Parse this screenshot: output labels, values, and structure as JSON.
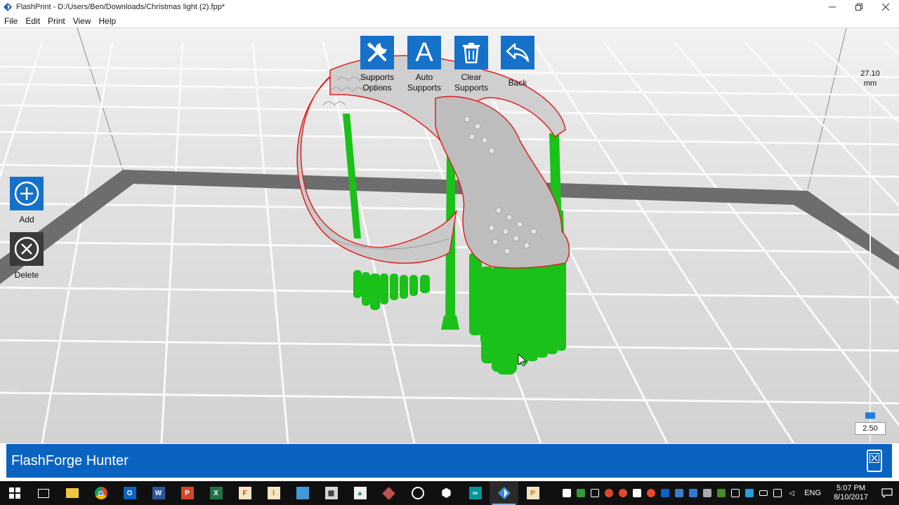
{
  "window": {
    "title": "FlashPrint - D:/Users/Ben/Downloads/Christmas light (2).fpp*",
    "app_icon": "flashprint-logo-icon"
  },
  "menu": {
    "items": [
      "File",
      "Edit",
      "Print",
      "View",
      "Help"
    ]
  },
  "toolbar": {
    "supports_options": "Supports Options",
    "auto_supports": "Auto Supports",
    "clear_supports": "Clear Supports",
    "back": "Back"
  },
  "side": {
    "add": "Add",
    "delete": "Delete"
  },
  "height_slider": {
    "top_value": "27.10",
    "top_unit": "mm",
    "current_value": "2.50"
  },
  "status": {
    "printer": "FlashForge Hunter"
  },
  "colors": {
    "accent": "#1671c9",
    "status_bar": "#0a63c0",
    "support": "#19c119",
    "model": "#c4c4c4",
    "outline": "#e02020"
  },
  "taskbar": {
    "apps": [
      "task-view-icon",
      "file-explorer-icon",
      "chrome-icon",
      "outlook-icon",
      "word-icon",
      "powerpoint-icon",
      "excel-icon",
      "app-f-icon",
      "app-i-icon",
      "app-monitor-icon",
      "calculator-icon",
      "app-chart-icon",
      "app-3d-icon",
      "obs-icon",
      "app-box-icon",
      "arduino-icon",
      "flashprint-icon",
      "app-p-icon"
    ],
    "language": "ENG",
    "time": "5:07 PM",
    "date": "8/10/2017"
  }
}
